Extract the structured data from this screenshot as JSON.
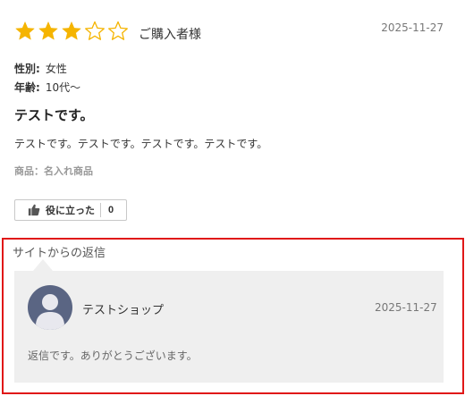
{
  "review": {
    "rating": 3,
    "rating_max": 5,
    "reviewer": "ご購入者様",
    "date": "2025-11-27",
    "gender_label": "性別:",
    "gender_value": "女性",
    "age_label": "年齢:",
    "age_value": "10代〜",
    "title": "テストです。",
    "body": "テストです。テストです。テストです。テストです。",
    "product": "商品：名入れ商品",
    "helpful_label": "役に立った",
    "helpful_count": "0"
  },
  "reply": {
    "heading": "サイトからの返信",
    "shop_name": "テストショップ",
    "date": "2025-11-27",
    "text": "返信です。ありがとうございます。"
  },
  "colors": {
    "star_filled": "#f5b400",
    "star_empty_stroke": "#f5b400",
    "highlight_border": "#e01818",
    "reply_bg": "#efefef",
    "avatar_bg": "#5a6583"
  },
  "icons": {
    "star": "star-icon",
    "thumb": "thumbs-up-icon",
    "avatar": "user-avatar-icon"
  }
}
